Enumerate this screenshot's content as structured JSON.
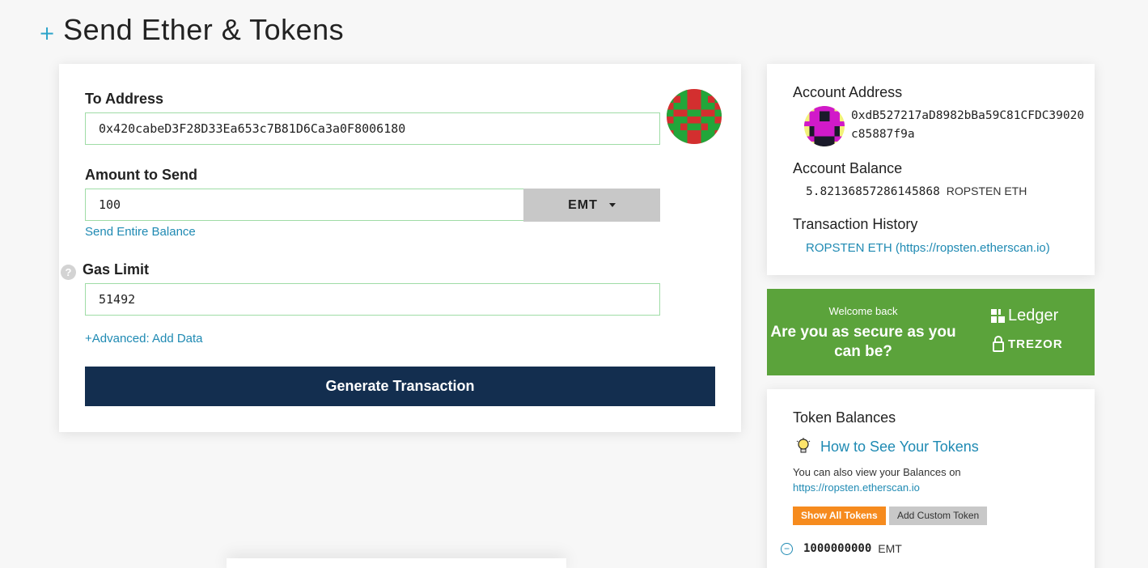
{
  "header": {
    "plus": "+",
    "title": "Send Ether & Tokens"
  },
  "form": {
    "to_address_label": "To Address",
    "to_address_value": "0x420cabeD3F28D33Ea653c7B81D6Ca3a0F8006180",
    "amount_label": "Amount to Send",
    "amount_value": "100",
    "unit_selected": "EMT",
    "send_entire_balance": "Send Entire Balance",
    "gas_help": "?",
    "gas_limit_label": "Gas Limit",
    "gas_limit_value": "51492",
    "advanced_link": "+Advanced: Add Data",
    "generate_button": "Generate Transaction"
  },
  "account": {
    "address_heading": "Account Address",
    "address": "0xdB527217aD8982bBa59C81CFDC39020c85887f9a",
    "balance_heading": "Account Balance",
    "balance_value": "5.82136857286145868",
    "balance_unit": "ROPSTEN ETH",
    "history_heading": "Transaction History",
    "history_link": "ROPSTEN ETH (https://ropsten.etherscan.io)"
  },
  "promo": {
    "welcome": "Welcome back",
    "headline": "Are you as secure as you can be?",
    "ledger": "Ledger",
    "trezor": "TREZOR",
    "background": "#5ba33b"
  },
  "tokens": {
    "heading": "Token Balances",
    "tip_icon": "lightbulb-icon",
    "tip_link": "How to See Your Tokens",
    "desc": "You can also view your Balances on",
    "desc_link": "https://ropsten.etherscan.io",
    "show_all": "Show All Tokens",
    "add_custom": "Add Custom Token",
    "items": [
      {
        "amount": "1000000000",
        "symbol": "EMT"
      }
    ]
  },
  "colors": {
    "accent": "#1f8ab3",
    "primary_button": "#132e4f",
    "input_border": "#9fdca6",
    "orange": "#f68b1e"
  }
}
